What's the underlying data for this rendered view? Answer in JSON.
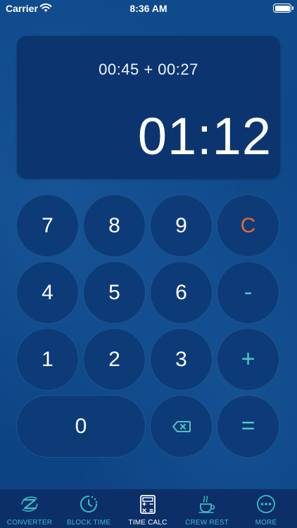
{
  "status_bar": {
    "carrier": "Carrier",
    "time": "8:36 AM"
  },
  "display": {
    "expression": "00:45 + 00:27",
    "result": "01:12"
  },
  "keypad": {
    "keys": [
      "7",
      "8",
      "9",
      "C",
      "4",
      "5",
      "6",
      "-",
      "1",
      "2",
      "3",
      "+",
      "0",
      "="
    ],
    "backspace_icon": "backspace-icon"
  },
  "tabbar": {
    "tabs": [
      {
        "label": "CONVERTER",
        "icon": "converter-icon",
        "active": false
      },
      {
        "label": "BLOCK TIME",
        "icon": "clock-icon",
        "active": false
      },
      {
        "label": "TIME CALC",
        "icon": "calculator-icon",
        "active": true
      },
      {
        "label": "CREW REST",
        "icon": "coffee-cup-icon",
        "active": false
      },
      {
        "label": "MORE",
        "icon": "more-icon",
        "active": false
      }
    ]
  },
  "colors": {
    "background": "#0d4584",
    "display_background": "#0c3570",
    "key_background": "#0d3b78",
    "accent_teal": "#4ec4c6",
    "clear_orange": "#e5663a",
    "tabbar_background": "#0c2f6a"
  }
}
